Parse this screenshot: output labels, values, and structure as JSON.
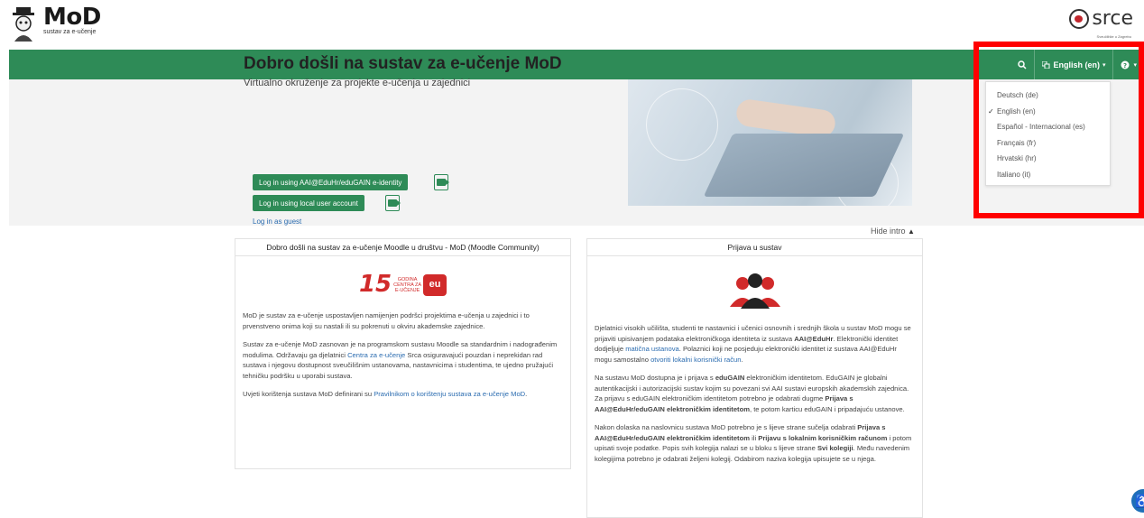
{
  "header": {
    "logo_title": "MoD",
    "logo_subtitle": "sustav za e-učenje",
    "partner_logo": "srce",
    "partner_tagline": "Sveučilište u Zagrebu"
  },
  "navbar": {
    "language_label": "English (en)",
    "search_icon": "search-icon",
    "help_icon": "question-circle-icon"
  },
  "hero": {
    "title": "Dobro došli na sustav za e-učenje MoD",
    "subtitle": "Virtualno okruženje za projekte e-učenja u zajednici",
    "login_aai": "Log in using AAI@EduHr/eduGAIN e-identity",
    "login_local": "Log in using local user account",
    "login_guest": "Log in as guest",
    "hide_intro": "Hide intro"
  },
  "card_left": {
    "heading": "Dobro došli na sustav za e-učenje Moodle u društvu - MoD (Moodle Community)",
    "badge_number": "15",
    "badge_text_1": "GODINA",
    "badge_text_2": "CENTRA ZA",
    "badge_text_3": "E-UČENJE",
    "badge_mark": "eu",
    "p1": "MoD je sustav za e-učenje uspostavljen namijenjen podršci projektima e-učenja u zajednici i to prvenstveno onima koji su nastali ili su pokrenuti u okviru akademske zajednice.",
    "p2_a": "Sustav za e-učenje MoD zasnovan je na programskom sustavu Moodle sa standardnim i nadograđenim modulima. Održavaju ga djelatnici ",
    "p2_link": "Centra za e-učenje",
    "p2_b": " Srca osiguravajući pouzdan i neprekidan rad sustava i njegovu dostupnost sveučilišnim ustanovama, nastavnicima i studentima, te ujedno pružajući tehničku podršku u uporabi sustava.",
    "p3_a": "Uvjeti korištenja sustava MoD definirani su ",
    "p3_link": "Pravilnikom o korištenju sustava za e-učenje MoD",
    "p3_b": "."
  },
  "card_right": {
    "heading": "Prijava u sustav",
    "p1_a": "Djelatnici visokih učilišta, studenti te nastavnici i učenici osnovnih i srednjih škola u sustav MoD mogu se prijaviti upisivanjem podataka elektroničkoga identiteta iz sustava ",
    "p1_b1": "AAI@EduHr",
    "p1_c": ". Elektronički identitet dodjeljuje ",
    "p1_link1": "matična ustanova",
    "p1_d": ". Polaznici koji ne posjeduju elektronički identitet iz sustava AAI@EduHr mogu samostalno ",
    "p1_link2": "otvoriti lokalni korisnički račun",
    "p1_e": ".",
    "p2_a": "Na sustavu MoD dostupna je i prijava s ",
    "p2_b1": "eduGAIN",
    "p2_c": " elektroničkim identitetom. EduGAIN je globalni autentikacijski i autorizacijski sustav kojim su povezani svi AAI sustavi europskih akademskih zajednica. Za prijavu s eduGAIN elektroničkim identitetom potrebno je odabrati dugme ",
    "p2_b2": "Prijava s AAI@EduHr/eduGAIN elektroničkim identitetom",
    "p2_d": ", te potom karticu eduGAIN i pripadajuću ustanove.",
    "p3_a": "Nakon dolaska na naslovnicu sustava MoD potrebno je s lijeve strane sučelja odabrati ",
    "p3_b1": "Prijava s AAI@EduHr/eduGAIN elektroničkim identitetom",
    "p3_c": " ili ",
    "p3_b2": "Prijavu s lokalnim korisničkim računom",
    "p3_d": " i potom upisati svoje podatke. Popis svih kolegija nalazi se u bloku s lijeve strane ",
    "p3_b3": "Svi kolegiji",
    "p3_e": ". Među navedenim kolegijima potrebno je odabrati željeni kolegij. Odabirom naziva kolegija upisujete se u njega."
  },
  "language_menu": {
    "items": [
      "Deutsch (de)",
      "English (en)",
      "Español - Internacional (es)",
      "Français (fr)",
      "Hrvatski (hr)",
      "Italiano (it)"
    ],
    "selected": "English (en)"
  },
  "colors": {
    "brand_green": "#2e8b57",
    "highlight_red": "#ff0000",
    "link_blue": "#2b6cb0"
  }
}
